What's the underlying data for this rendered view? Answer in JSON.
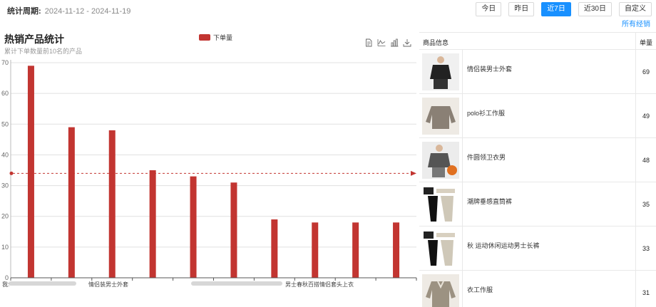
{
  "header": {
    "period_label": "统计周期:",
    "period_value": "2024-11-12 - 2024-11-19",
    "range_buttons": [
      "今日",
      "昨日",
      "近7日",
      "近30日",
      "自定义"
    ],
    "active_range": "近7日",
    "all_stores_link": "所有经销"
  },
  "chart_panel": {
    "title": "热销产品统计",
    "subtitle": "累计下单数量前10名的产品",
    "legend_label": "下单量",
    "toolbox_icons": [
      "data-view-icon",
      "line-chart-icon",
      "bar-chart-icon",
      "download-icon"
    ]
  },
  "chart_data": {
    "type": "bar",
    "title": "热销产品统计",
    "subtitle": "累计下单数量前10名的产品",
    "series": [
      {
        "name": "下单量",
        "color": "#c23531",
        "values": [
          69,
          49,
          48,
          35,
          33,
          31,
          19,
          18,
          18,
          18
        ]
      }
    ],
    "categories": [
      "",
      "",
      "",
      "",
      "",
      "",
      "",
      "",
      "",
      ""
    ],
    "visible_x_tick_texts": [
      "我:",
      "情侣装男士外套",
      "男士春秋百搭情侣套头上衣"
    ],
    "ylim": [
      0,
      70
    ],
    "yticks": [
      0,
      10,
      20,
      30,
      40,
      50,
      60,
      70
    ],
    "average_line": 34,
    "grid": true,
    "legend_position": "top-center"
  },
  "table": {
    "headers": [
      "商品信息",
      "单量"
    ],
    "rows": [
      {
        "name": "情侣装男士外套",
        "count": "69",
        "thumb": "black-hoodie"
      },
      {
        "name": "polo衫工作服",
        "count": "49",
        "thumb": "grey-sweatshirt"
      },
      {
        "name": "件圆领卫衣男",
        "count": "48",
        "thumb": "grey-crewneck"
      },
      {
        "name": "潮牌垂感直筒裤",
        "count": "35",
        "thumb": "trousers"
      },
      {
        "name": "秋 运动休闲运动男士长裤",
        "count": "33",
        "thumb": "trousers"
      },
      {
        "name": "衣工作服",
        "count": "31",
        "thumb": "khaki-polo"
      }
    ]
  }
}
